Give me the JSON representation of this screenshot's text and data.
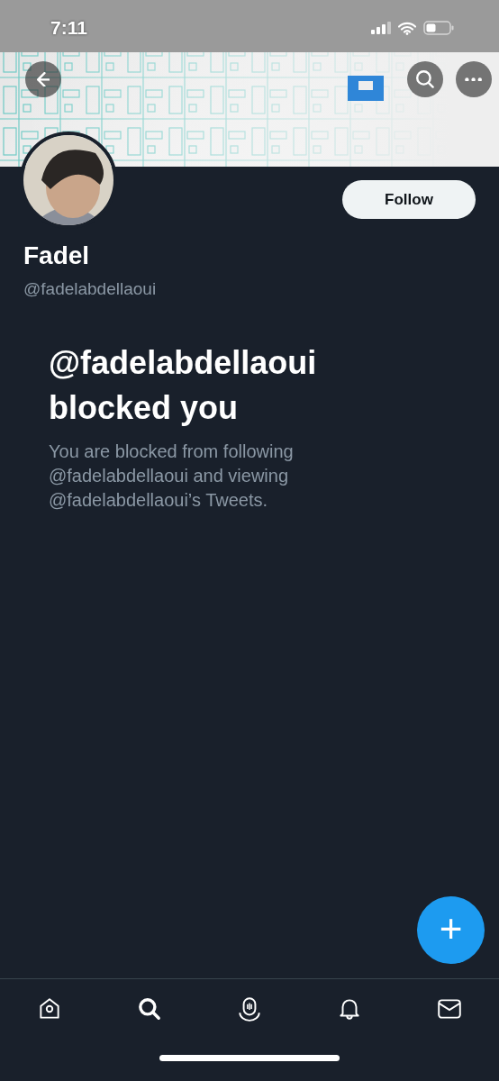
{
  "status_bar": {
    "time": "7:11"
  },
  "header": {
    "buttons": [
      {
        "kind": "back"
      },
      {
        "kind": "search"
      },
      {
        "kind": "more"
      }
    ]
  },
  "profile": {
    "name": "Fadel",
    "handle": "@fadelabdellaoui",
    "follow_button": "Follow"
  },
  "blocked_notice": {
    "title": "@fadelabdellaoui blocked you",
    "message": "You are blocked from following @fadelabdellaoui and viewing @fadelabdellaoui’s Tweets."
  },
  "compose_button": {
    "label": "+"
  },
  "tab_bar": [
    {
      "kind": "home",
      "selected": false
    },
    {
      "kind": "search",
      "selected": true
    },
    {
      "kind": "spaces",
      "selected": false
    },
    {
      "kind": "notifications",
      "selected": false
    },
    {
      "kind": "messages",
      "selected": false
    }
  ]
}
